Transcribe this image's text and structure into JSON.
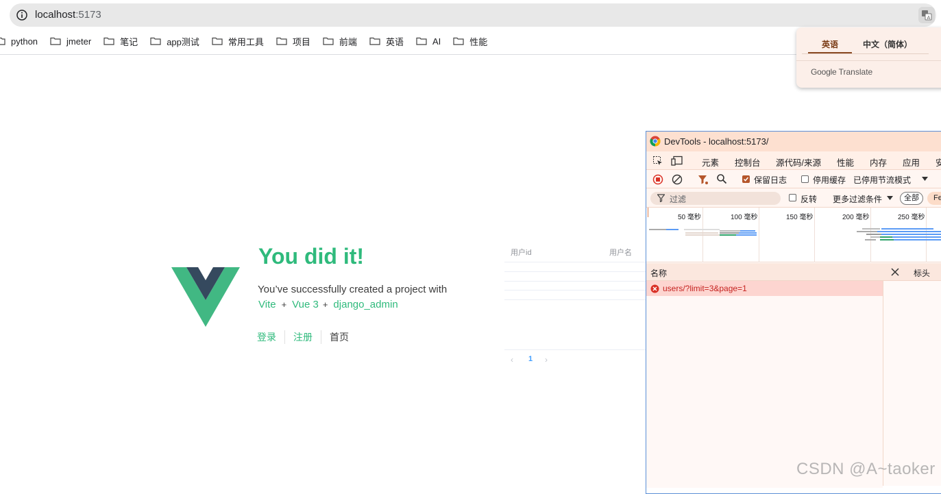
{
  "browser": {
    "url_host": "localhost",
    "url_port": ":5173",
    "bookmarks": [
      "python",
      "jmeter",
      "笔记",
      "app测试",
      "常用工具",
      "项目",
      "前端",
      "英语",
      "AI",
      "性能"
    ]
  },
  "translate_popup": {
    "tab_source": "英语",
    "tab_target": "中文（简体）",
    "brand": "Google",
    "brand_suffix": "Translate"
  },
  "page": {
    "title": "You did it!",
    "subtitle": "You’ve successfully created a project with",
    "tech": [
      "Vite",
      "Vue 3",
      "django_admin"
    ],
    "plus": "+",
    "nav": [
      "登录",
      "注册",
      "首页"
    ],
    "table_headers": [
      "用户id",
      "用户名"
    ],
    "pager": {
      "prev": "‹",
      "current": "1",
      "next": "›"
    }
  },
  "devtools": {
    "title": "DevTools - localhost:5173/",
    "tabs": [
      "元素",
      "控制台",
      "源代码/来源",
      "性能",
      "内存",
      "应用",
      "安"
    ],
    "toolbar": {
      "preserve_log": "保留日志",
      "disable_cache": "停用缓存",
      "throttle": "已停用节流模式"
    },
    "filter": {
      "placeholder": "过滤",
      "invert": "反转",
      "more_filters": "更多过滤条件",
      "all": "全部",
      "fetch_short": "Fe"
    },
    "timeline_ticks": [
      "50 毫秒",
      "100 毫秒",
      "150 毫秒",
      "200 毫秒",
      "250 毫秒"
    ],
    "column_name": "名称",
    "right_tab": "标头",
    "requests": [
      {
        "name": "users/?limit=3&page=1",
        "status": "error"
      }
    ]
  },
  "watermark": "CSDN @A~taoker",
  "colors": {
    "vue_green": "#2fba7c",
    "vue_dark": "#35495e",
    "error_red": "#c5221f"
  }
}
